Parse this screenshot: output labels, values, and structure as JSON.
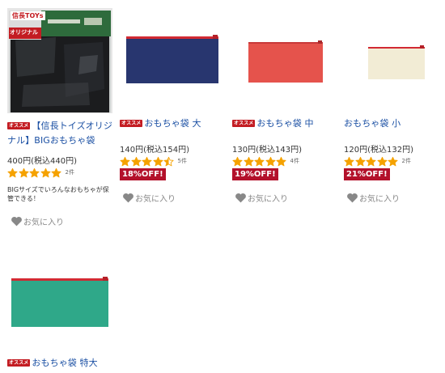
{
  "products": [
    {
      "badge": "オススメ",
      "title": "【信長トイズオリジナル】BIGおもちゃ袋",
      "price": "400円(税込440円)",
      "rating": 5,
      "review_count": "2件",
      "description": "BIGサイズでいろんなおもちゃが保管できる！",
      "favorite": "お気に入り",
      "package_brand": "信長TOYs",
      "package_label": "オリジナル"
    },
    {
      "badge": "オススメ",
      "title": "おもちゃ袋 大",
      "price": "140円(税込154円)",
      "rating": 4.5,
      "review_count": "5件",
      "discount": "18%OFF!",
      "favorite": "お気に入り"
    },
    {
      "badge": "オススメ",
      "title": "おもちゃ袋 中",
      "price": "130円(税込143円)",
      "rating": 5,
      "review_count": "4件",
      "discount": "19%OFF!",
      "favorite": "お気に入り"
    },
    {
      "title": "おもちゃ袋 小",
      "price": "120円(税込132円)",
      "rating": 5,
      "review_count": "2件",
      "discount": "21%OFF!",
      "favorite": "お気に入り"
    },
    {
      "badge": "オススメ",
      "title": "おもちゃ袋 特大"
    }
  ],
  "colors": {
    "link": "#1a4fa3",
    "star": "#f5a200",
    "discount_bg": "#b3112b",
    "badge_bg": "#c31c22",
    "pouch_navy": "#28366f",
    "pouch_red": "#e5534c",
    "pouch_cream": "#f2ecd5",
    "pouch_green": "#2fa889",
    "zip_red": "#d22a33"
  },
  "icons": [
    "star-icon",
    "heart-icon"
  ]
}
